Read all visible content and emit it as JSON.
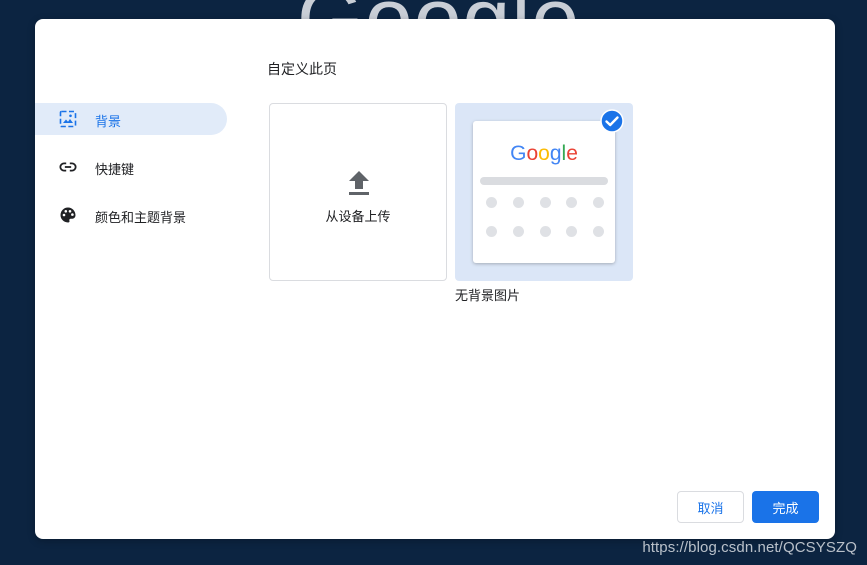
{
  "background": {
    "logo_text": "Google"
  },
  "watermark": "https://blog.csdn.net/QCSYSZQ",
  "dialog": {
    "title": "自定义此页",
    "sidebar": {
      "items": [
        {
          "label": "背景",
          "icon": "image-icon",
          "active": true
        },
        {
          "label": "快捷键",
          "icon": "link-icon",
          "active": false
        },
        {
          "label": "颜色和主题背景",
          "icon": "palette-icon",
          "active": false
        }
      ]
    },
    "tiles": {
      "upload_label": "从设备上传",
      "no_background_label": "无背景图片",
      "no_background_selected": true,
      "preview_logo": [
        "G",
        "o",
        "o",
        "g",
        "l",
        "e"
      ]
    },
    "buttons": {
      "cancel": "取消",
      "done": "完成"
    }
  },
  "colors": {
    "accent": "#1a73e8",
    "active_nav_bg": "#e1ebf9",
    "selected_tile_bg": "#dbe6f7",
    "backdrop": "#0c2441",
    "logo_blue": "#4285f4",
    "logo_red": "#ea4335",
    "logo_yellow": "#fbbc05",
    "logo_green": "#34a853"
  }
}
